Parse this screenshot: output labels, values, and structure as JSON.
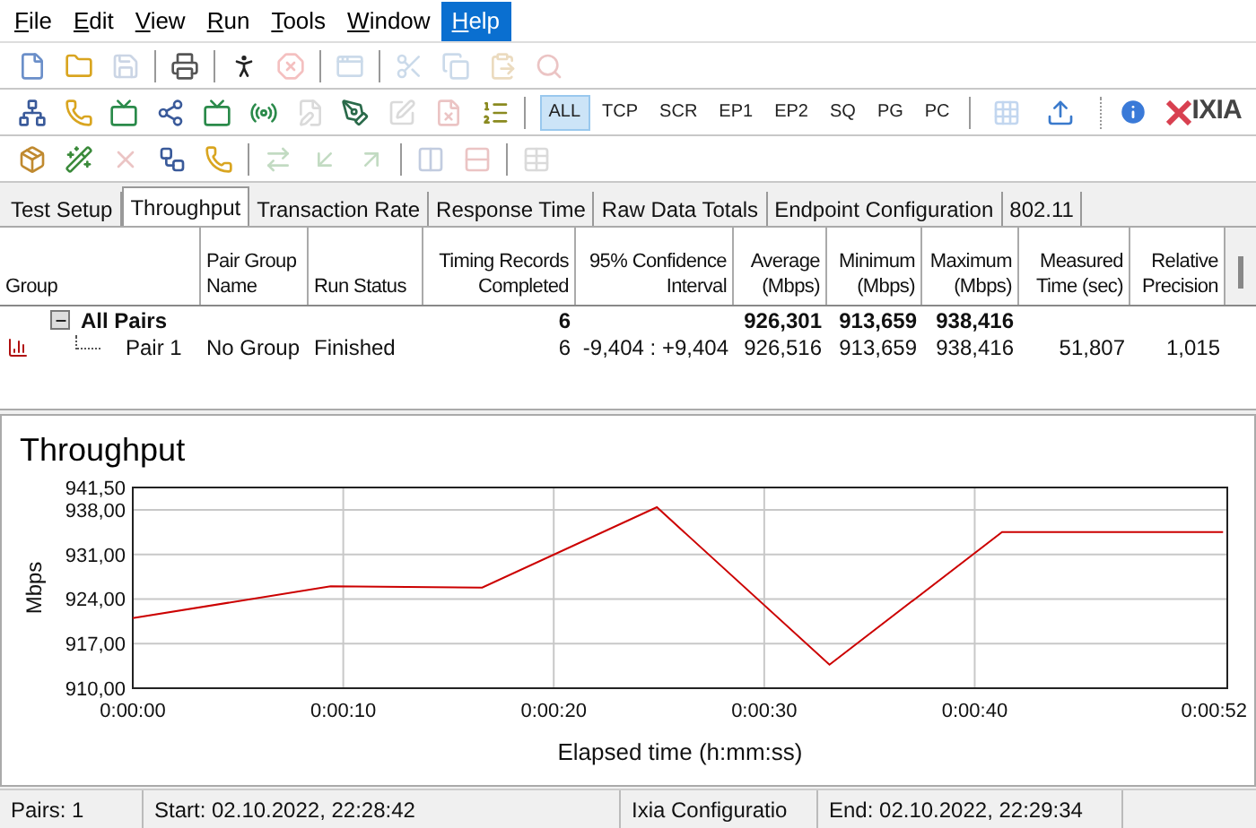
{
  "menu": [
    {
      "label": "File",
      "selected": false
    },
    {
      "label": "Edit",
      "selected": false
    },
    {
      "label": "View",
      "selected": false
    },
    {
      "label": "Run",
      "selected": false
    },
    {
      "label": "Tools",
      "selected": false
    },
    {
      "label": "Window",
      "selected": false
    },
    {
      "label": "Help",
      "selected": true
    }
  ],
  "toolbars": [
    {
      "items": [
        {
          "kind": "button",
          "disabled": false
        },
        {
          "kind": "button",
          "disabled": false
        },
        {
          "kind": "button",
          "disabled": true
        },
        {
          "kind": "separator"
        },
        {
          "kind": "button",
          "disabled": false
        },
        {
          "kind": "separator"
        },
        {
          "kind": "button",
          "disabled": false
        },
        {
          "kind": "button",
          "disabled": true
        },
        {
          "kind": "separator"
        },
        {
          "kind": "button",
          "disabled": true
        },
        {
          "kind": "separator"
        },
        {
          "kind": "button",
          "disabled": true
        },
        {
          "kind": "button",
          "disabled": true
        },
        {
          "kind": "button",
          "disabled": true
        },
        {
          "kind": "button",
          "disabled": true
        }
      ]
    },
    {
      "items": [
        {
          "kind": "button",
          "disabled": false
        },
        {
          "kind": "button",
          "disabled": false
        },
        {
          "kind": "button",
          "disabled": false
        },
        {
          "kind": "button",
          "disabled": false
        },
        {
          "kind": "button",
          "disabled": false
        },
        {
          "kind": "button",
          "disabled": false
        },
        {
          "kind": "button",
          "disabled": true
        },
        {
          "kind": "button",
          "disabled": false
        },
        {
          "kind": "button",
          "disabled": true
        },
        {
          "kind": "button",
          "disabled": true
        },
        {
          "kind": "button",
          "disabled": false
        },
        {
          "kind": "separator"
        }
      ]
    },
    {
      "items": [
        {
          "kind": "button",
          "disabled": false
        },
        {
          "kind": "button",
          "disabled": false
        },
        {
          "kind": "button",
          "disabled": true
        },
        {
          "kind": "button",
          "disabled": false
        },
        {
          "kind": "button",
          "disabled": false
        },
        {
          "kind": "separator"
        },
        {
          "kind": "button",
          "disabled": true
        },
        {
          "kind": "button",
          "disabled": true
        },
        {
          "kind": "button",
          "disabled": true
        },
        {
          "kind": "separator"
        },
        {
          "kind": "button",
          "disabled": true
        },
        {
          "kind": "button",
          "disabled": true
        },
        {
          "kind": "separator"
        },
        {
          "kind": "button",
          "disabled": true
        }
      ]
    }
  ],
  "filters": [
    {
      "label": "ALL",
      "selected": true
    },
    {
      "label": "TCP",
      "selected": false
    },
    {
      "label": "SCR",
      "selected": false
    },
    {
      "label": "EP1",
      "selected": false
    },
    {
      "label": "EP2",
      "selected": false
    },
    {
      "label": "SQ",
      "selected": false
    },
    {
      "label": "PG",
      "selected": false
    },
    {
      "label": "PC",
      "selected": false
    }
  ],
  "filter_tools": [
    {
      "disabled": true
    },
    {
      "disabled": false
    }
  ],
  "logo": "IXIA",
  "tabs": [
    {
      "label": "Test Setup",
      "selected": false
    },
    {
      "label": "Throughput",
      "selected": true
    },
    {
      "label": "Transaction Rate",
      "selected": false
    },
    {
      "label": "Response Time",
      "selected": false
    },
    {
      "label": "Raw Data Totals",
      "selected": false
    },
    {
      "label": "Endpoint Configuration",
      "selected": false
    },
    {
      "label": "802.11",
      "selected": false
    }
  ],
  "table": {
    "columns": [
      "Group",
      "Pair Group Name",
      "Run Status",
      "Timing Records Completed",
      "95% Confidence Interval",
      "Average (Mbps)",
      "Minimum (Mbps)",
      "Maximum (Mbps)",
      "Measured Time (sec)",
      "Relative Precision"
    ],
    "rows": [
      {
        "kind": "group",
        "expanded": true,
        "cells": [
          "All Pairs",
          null,
          null,
          "6",
          null,
          "926,301",
          "913,659",
          "938,416",
          null,
          null
        ]
      },
      {
        "kind": "pair",
        "cells": [
          "Pair 1",
          "No Group",
          "Finished",
          "6",
          "-9,404 : +9,404",
          "926,516",
          "913,659",
          "938,416",
          "51,807",
          "1,015"
        ]
      }
    ]
  },
  "chart": {
    "chart_data": {
      "type": "line",
      "title": "Throughput",
      "xlabel": "Elapsed time (h:mm:ss)",
      "ylabel": "Mbps",
      "x": [
        0,
        9.4,
        16.6,
        24.9,
        33.1,
        41.3,
        51.8
      ],
      "grid": true,
      "series": [
        {
          "color": "#cc0000",
          "values": [
            921.0,
            926.0,
            925.8,
            938.4,
            913.7,
            934.5,
            934.5
          ]
        }
      ],
      "xlim": [
        0,
        52
      ],
      "ylim": [
        910,
        941.5
      ],
      "xticks": [
        {
          "value": 0,
          "label": "0:00:00"
        },
        {
          "value": 10,
          "label": "0:00:10"
        },
        {
          "value": 20,
          "label": "0:00:20"
        },
        {
          "value": 30,
          "label": "0:00:30"
        },
        {
          "value": 40,
          "label": "0:00:40"
        },
        {
          "value": 52,
          "label": "0:00:52"
        }
      ],
      "yticks": [
        {
          "value": 910,
          "label": "910,00"
        },
        {
          "value": 917,
          "label": "917,00"
        },
        {
          "value": 924,
          "label": "924,00"
        },
        {
          "value": 931,
          "label": "931,00"
        },
        {
          "value": 938,
          "label": "938,00"
        },
        {
          "value": 941.5,
          "label": "941,50"
        }
      ]
    }
  },
  "status_bar": [
    "Pairs: 1",
    "Start: 02.10.2022, 22:28:42",
    "Ixia Configuratio",
    "End: 02.10.2022, 22:29:34"
  ]
}
